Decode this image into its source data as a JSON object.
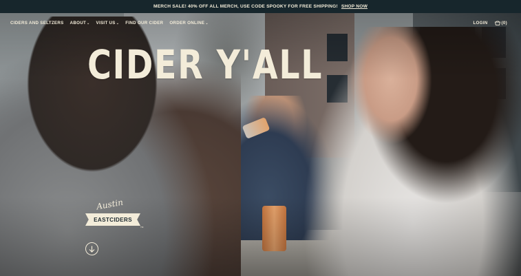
{
  "announcement": {
    "text": "MERCH SALE! 40% OFF ALL MERCH, USE CODE SPOOKY FOR FREE SHIPPING!",
    "link": "SHOP NOW"
  },
  "nav": {
    "items": [
      {
        "label": "CIDERS AND SELTZERS",
        "has_dropdown": false
      },
      {
        "label": "ABOUT",
        "has_dropdown": true
      },
      {
        "label": "VISIT US",
        "has_dropdown": true
      },
      {
        "label": "FIND OUR CIDER",
        "has_dropdown": false
      },
      {
        "label": "ORDER ONLINE",
        "has_dropdown": true
      }
    ],
    "caret": "⌄",
    "login": "LOGIN",
    "cart_count": "(0)"
  },
  "hero": {
    "headline": "CIDER Y'ALL"
  },
  "logo": {
    "script": "Austin",
    "banner": "EASTCIDERS",
    "tm": "TM"
  },
  "icons": {
    "cart": "basket-icon",
    "scroll": "arrow-down-icon"
  },
  "colors": {
    "cream": "#f3ecd9",
    "announcement_bg": "#17262c"
  }
}
